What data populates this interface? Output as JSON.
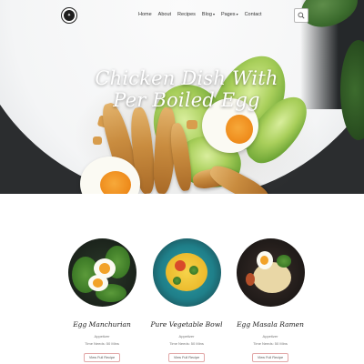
{
  "nav": {
    "logo_text": "✦",
    "items": [
      {
        "label": "Home"
      },
      {
        "label": "About"
      },
      {
        "label": "Recipes"
      },
      {
        "label": "Blog"
      },
      {
        "label": "Pages"
      },
      {
        "label": "Contact"
      }
    ],
    "search_icon": "search-icon"
  },
  "hero": {
    "title_line1": "Chicken Dish With",
    "title_line2": "Per Boiled Egg"
  },
  "recipes": [
    {
      "title": "Egg Manchurian",
      "category": "Appetizer",
      "time": "Time Needs: 50 Mins",
      "button": "View Full Recipe"
    },
    {
      "title": "Pure Vegetable Bowl",
      "category": "Appetizer",
      "time": "Time Needs: 50 Mins",
      "button": "View Full Recipe"
    },
    {
      "title": "Egg Masala Ramen",
      "category": "Appetizer",
      "time": "Time Needs: 50 Mins",
      "button": "View Full Recipe"
    }
  ],
  "colors": {
    "hero_bg": "#2b2d2f",
    "button_border": "#e2a8a8",
    "text_dark": "#222222"
  }
}
